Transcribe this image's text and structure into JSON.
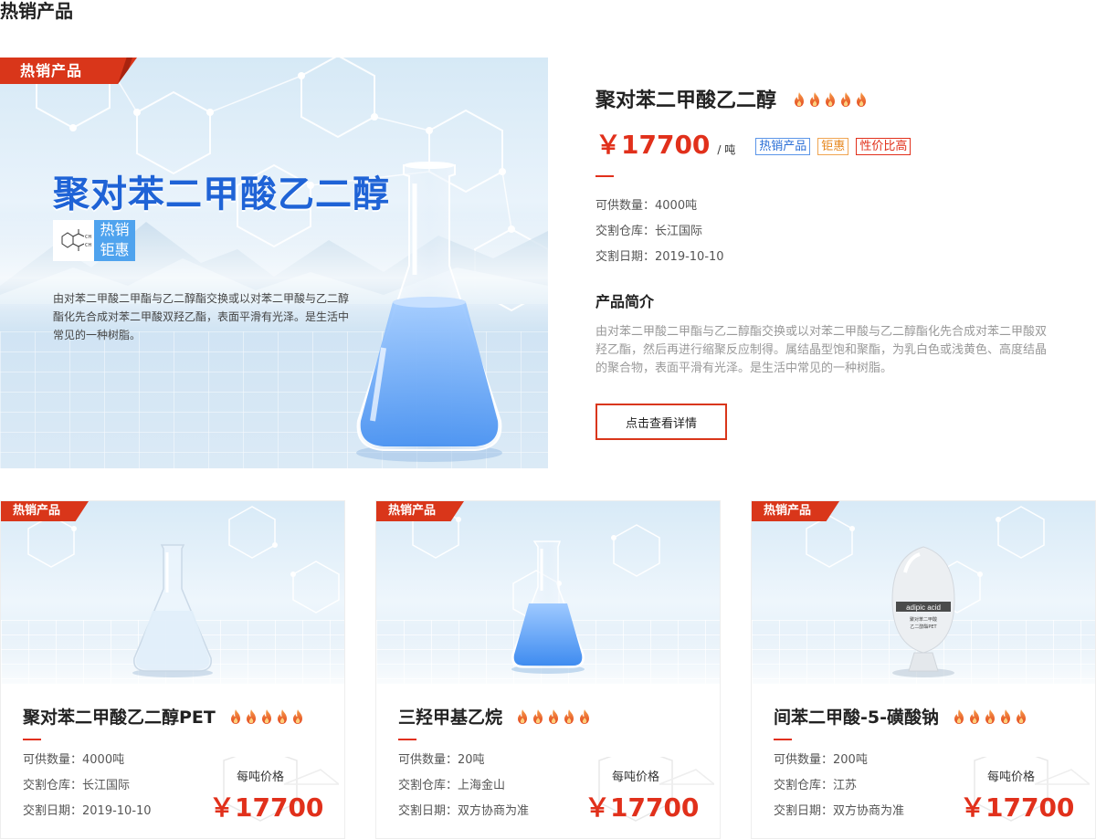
{
  "section_title": "热销产品",
  "featured": {
    "ribbon": "热销产品",
    "headline": "聚对苯二甲酸乙二醇",
    "badge_line1": "热销",
    "badge_line2": "钜惠",
    "image_desc": "由对苯二甲酸二甲酯与乙二醇酯交换或以对苯二甲酸与乙二醇酯化先合成对苯二甲酸双羟乙酯，表面平滑有光泽。是生活中常见的一种树脂。",
    "name": "聚对苯二甲酸乙二醇",
    "heat": 5,
    "price": "￥17700",
    "unit": "/ 吨",
    "tags": [
      "热销产品",
      "钜惠",
      "性价比高"
    ],
    "supply": "可供数量：4000吨",
    "warehouse": "交割仓库：长江国际",
    "date": "交割日期：2019-10-10",
    "intro_title": "产品简介",
    "intro_text": "由对苯二甲酸二甲酯与乙二醇酯交换或以对苯二甲酸与乙二醇酯化先合成对苯二甲酸双羟乙酯，然后再进行缩聚反应制得。属结晶型饱和聚酯，为乳白色或浅黄色、高度结晶的聚合物，表面平滑有光泽。是生活中常见的一种树脂。",
    "detail_button": "点击查看详情"
  },
  "cards": [
    {
      "ribbon": "热销产品",
      "name": "聚对苯二甲酸乙二醇PET",
      "heat": 5,
      "supply": "可供数量：4000吨",
      "warehouse": "交割仓库：长江国际",
      "date": "交割日期：2019-10-10",
      "price_label": "每吨价格",
      "price": "￥17700"
    },
    {
      "ribbon": "热销产品",
      "name": "三羟甲基乙烷",
      "heat": 5,
      "supply": "可供数量：20吨",
      "warehouse": "交割仓库：上海金山",
      "date": "交割日期：双方协商为准",
      "price_label": "每吨价格",
      "price": "￥17700"
    },
    {
      "ribbon": "热销产品",
      "name": "间苯二甲酸-5-磺酸钠",
      "heat": 5,
      "supply": "可供数量：200吨",
      "warehouse": "交割仓库：江苏",
      "date": "交割日期：双方协商为准",
      "price_label": "每吨价格",
      "price": "￥17700",
      "bottle_label_1": "adipic acid",
      "bottle_label_2": "聚对苯二甲酸",
      "bottle_label_3": "乙二醇酯PET"
    }
  ],
  "colors": {
    "accent": "#e1301b",
    "ribbon": "#d9361a",
    "blue": "#1f63d6"
  },
  "icons": [
    "flame-icon",
    "molecule-icon",
    "flask-icon",
    "bottle-icon"
  ]
}
